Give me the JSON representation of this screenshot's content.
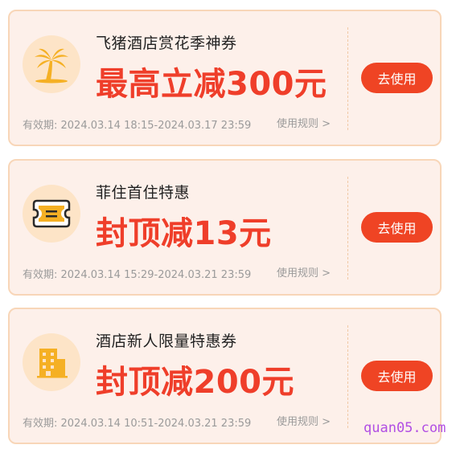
{
  "coupons": [
    {
      "icon": "palm-tree-icon",
      "title": "飞猪酒店赏花季神券",
      "amount": "最高立减300元",
      "validity": "有效期: 2024.03.14 18:15-2024.03.17 23:59",
      "rules": "使用规则 >",
      "button": "去使用"
    },
    {
      "icon": "ticket-icon",
      "title": "菲住首住特惠",
      "amount": "封顶减13元",
      "validity": "有效期: 2024.03.14 15:29-2024.03.21 23:59",
      "rules": "使用规则 >",
      "button": "去使用"
    },
    {
      "icon": "hotel-building-icon",
      "title": "酒店新人限量特惠券",
      "amount": "封顶减200元",
      "validity": "有效期: 2024.03.14 10:51-2024.03.21 23:59",
      "rules": "使用规则 >",
      "button": "去使用"
    }
  ],
  "watermark": "quan05.com",
  "colors": {
    "card_bg": "#fdf0ea",
    "card_border": "#f8d6b8",
    "accent_red": "#ef3e2a",
    "button_bg": "#ef4424",
    "icon_bg": "#fde4c7",
    "icon_fill": "#f5b024",
    "watermark": "#b14ee4"
  }
}
